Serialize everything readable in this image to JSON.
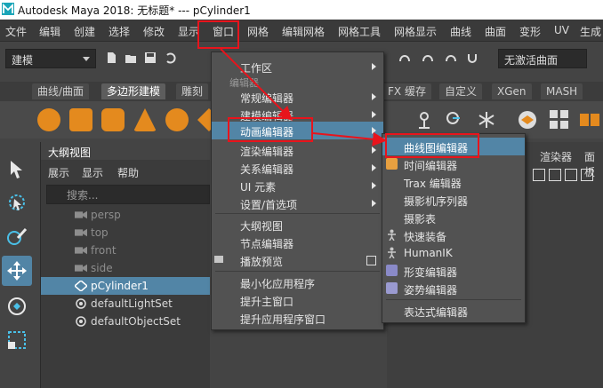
{
  "window": {
    "title": "Autodesk Maya 2018: 无标题*   ---   pCylinder1"
  },
  "menubar": [
    "文件",
    "编辑",
    "创建",
    "选择",
    "修改",
    "显示",
    "窗口",
    "网格",
    "编辑网格",
    "网格工具",
    "网格显示",
    "曲线",
    "曲面",
    "变形",
    "UV",
    "生成"
  ],
  "toolbar": {
    "mode": "建模",
    "live_surface": "无激活曲面"
  },
  "shelf": {
    "tabs": [
      "曲线/曲面",
      "多边形建模",
      "雕刻",
      "FX 缓存",
      "自定义",
      "XGen",
      "MASH"
    ],
    "active_tab": "多边形建模"
  },
  "outliner": {
    "title": "大纲视图",
    "menus": [
      "展示",
      "显示",
      "帮助"
    ],
    "search_placeholder": "搜索...",
    "items": [
      {
        "label": "persp",
        "state": "dim"
      },
      {
        "label": "top",
        "state": "dim"
      },
      {
        "label": "front",
        "state": "dim"
      },
      {
        "label": "side",
        "state": "dim"
      },
      {
        "label": "pCylinder1",
        "state": "selected"
      },
      {
        "label": "defaultLightSet",
        "state": "normal"
      },
      {
        "label": "defaultObjectSet",
        "state": "normal"
      }
    ]
  },
  "viewport_menus": [
    "渲染器",
    "面板"
  ],
  "window_menu": {
    "items": [
      "工作区"
    ],
    "section": "编辑器",
    "editors": [
      "常规编辑器",
      "建模编辑器",
      "动画编辑器",
      "渲染编辑器",
      "关系编辑器",
      "UI 元素",
      "设置/首选项"
    ],
    "highlighted": "动画编辑器",
    "group2": [
      "大纲视图",
      "节点编辑器",
      "播放预览"
    ],
    "group3": [
      "最小化应用程序",
      "提升主窗口",
      "提升应用程序窗口"
    ]
  },
  "anim_submenu": {
    "items": [
      "曲线图编辑器",
      "时间编辑器",
      "Trax 编辑器",
      "摄影机序列器",
      "摄影表",
      "快速装备",
      "HumanIK",
      "形变编辑器",
      "姿势编辑器"
    ],
    "footer": "表达式编辑器"
  },
  "colors": {
    "highlight": "#5285a6",
    "annotation": "#e8141c"
  }
}
